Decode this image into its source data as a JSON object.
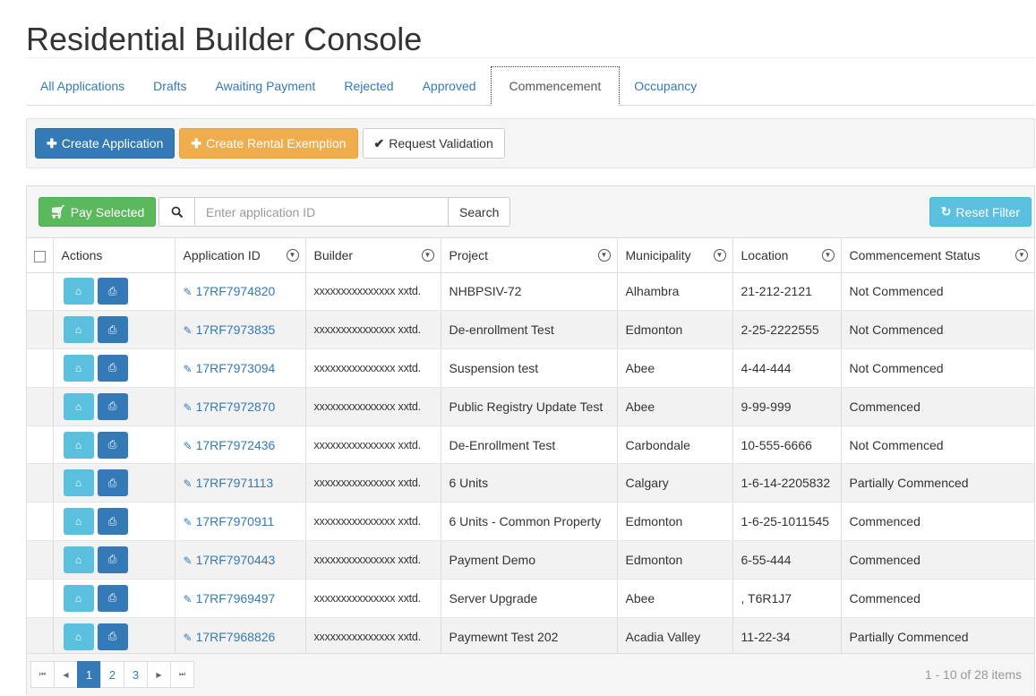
{
  "page": {
    "title": "Residential Builder Console"
  },
  "tabs": [
    {
      "label": "All Applications"
    },
    {
      "label": "Drafts"
    },
    {
      "label": "Awaiting Payment"
    },
    {
      "label": "Rejected"
    },
    {
      "label": "Approved"
    },
    {
      "label": "Commencement",
      "active": true
    },
    {
      "label": "Occupancy"
    }
  ],
  "toolbar": {
    "create_application": "Create Application",
    "create_rental_exemption": "Create Rental Exemption",
    "request_validation": "Request Validation"
  },
  "grid": {
    "pay_selected": "Pay Selected",
    "search_placeholder": "Enter application ID",
    "search_button": "Search",
    "reset_filter": "Reset Filter",
    "columns": [
      "Actions",
      "Application ID",
      "Builder",
      "Project",
      "Municipality",
      "Location",
      "Commencement Status"
    ],
    "rows": [
      {
        "id": "17RF7974820",
        "builder": "xxxxxxxxxxxxxxx xxtd.",
        "project": "NHBPSIV-72",
        "municipality": "Alhambra",
        "location": "21-212-2121",
        "status": "Not Commenced"
      },
      {
        "id": "17RF7973835",
        "builder": "xxxxxxxxxxxxxxx xxtd.",
        "project": "De-enrollment Test",
        "municipality": "Edmonton",
        "location": "2-25-2222555",
        "status": "Not Commenced"
      },
      {
        "id": "17RF7973094",
        "builder": "xxxxxxxxxxxxxxx xxtd.",
        "project": "Suspension test",
        "municipality": "Abee",
        "location": "4-44-444",
        "status": "Not Commenced"
      },
      {
        "id": "17RF7972870",
        "builder": "xxxxxxxxxxxxxxx xxtd.",
        "project": "Public Registry Update Test",
        "municipality": "Abee",
        "location": "9-99-999",
        "status": "Commenced"
      },
      {
        "id": "17RF7972436",
        "builder": "xxxxxxxxxxxxxxx xxtd.",
        "project": "De-Enrollment Test",
        "municipality": "Carbondale",
        "location": "10-555-6666",
        "status": "Not Commenced"
      },
      {
        "id": "17RF7971113",
        "builder": "xxxxxxxxxxxxxxx xxtd.",
        "project": "6 Units",
        "municipality": "Calgary",
        "location": "1-6-14-2205832",
        "status": "Partially Commenced"
      },
      {
        "id": "17RF7970911",
        "builder": "xxxxxxxxxxxxxxx xxtd.",
        "project": "6 Units - Common Property",
        "municipality": "Edmonton",
        "location": "1-6-25-1011545",
        "status": "Commenced"
      },
      {
        "id": "17RF7970443",
        "builder": "xxxxxxxxxxxxxxx xxtd.",
        "project": "Payment Demo",
        "municipality": "Edmonton",
        "location": "6-55-444",
        "status": "Commenced"
      },
      {
        "id": "17RF7969497",
        "builder": "xxxxxxxxxxxxxxx xxtd.",
        "project": "Server Upgrade",
        "municipality": "Abee",
        "location": ", T6R1J7",
        "status": "Commenced"
      },
      {
        "id": "17RF7968826",
        "builder": "xxxxxxxxxxxxxxx xxtd.",
        "project": "Paymewnt Test 202",
        "municipality": "Acadia Valley",
        "location": "11-22-34",
        "status": "Partially Commenced"
      }
    ]
  },
  "pager": {
    "pages": [
      "1",
      "2",
      "3"
    ],
    "current": "1",
    "info": "1 - 10 of 28 items"
  }
}
